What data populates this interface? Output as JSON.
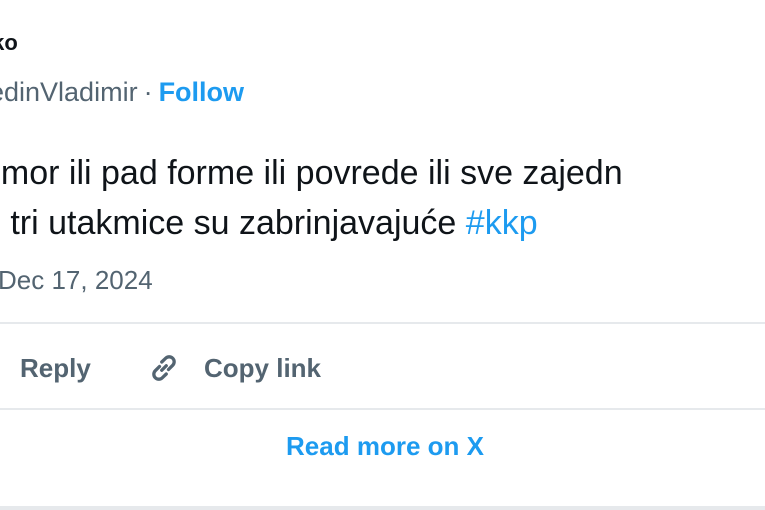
{
  "author": {
    "display_name": "jko",
    "handle": "redinVladimir",
    "separator": "·",
    "follow_label": "Follow"
  },
  "tweet": {
    "line1": "umor ili pad forme ili povrede ili sve zajedn",
    "line2_prefix": "e tri utakmice su zabrinjavajuće ",
    "hashtag": "#kkp",
    "date": "Dec 17, 2024"
  },
  "actions": {
    "reply_label": "Reply",
    "copy_link_label": "Copy link",
    "copy_link_icon": "link-icon"
  },
  "footer": {
    "read_more_label": "Read more on X"
  },
  "colors": {
    "accent": "#1d9bf0",
    "text": "#0f1419",
    "secondary": "#536471",
    "divider": "#e6e9ec"
  }
}
